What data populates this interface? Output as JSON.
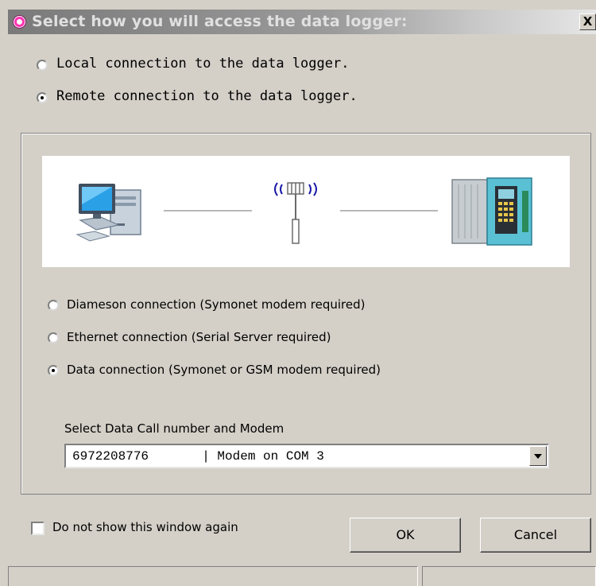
{
  "window": {
    "title": "Select how you will access the data logger:",
    "close_label": "X"
  },
  "access_options": [
    {
      "label": "Local connection to the data logger.",
      "checked": false
    },
    {
      "label": "Remote connection to the data logger.",
      "checked": true
    }
  ],
  "diagram": {
    "left_icon": "desktop-computer-icon",
    "center_icon": "antenna-tower-icon",
    "right_icon": "data-logger-cabinet-icon"
  },
  "remote_options": [
    {
      "label": "Diameson connection (Symonet modem required)",
      "checked": false
    },
    {
      "label": "Ethernet connection (Serial Server required)",
      "checked": false
    },
    {
      "label": "Data connection (Symonet or GSM modem required)",
      "checked": true
    }
  ],
  "modem_select": {
    "label": "Select Data Call number and Modem",
    "value": "6972208776       | Modem on COM 3"
  },
  "footer": {
    "dont_show_label": "Do not show this window again",
    "ok_label": "OK",
    "cancel_label": "Cancel"
  }
}
